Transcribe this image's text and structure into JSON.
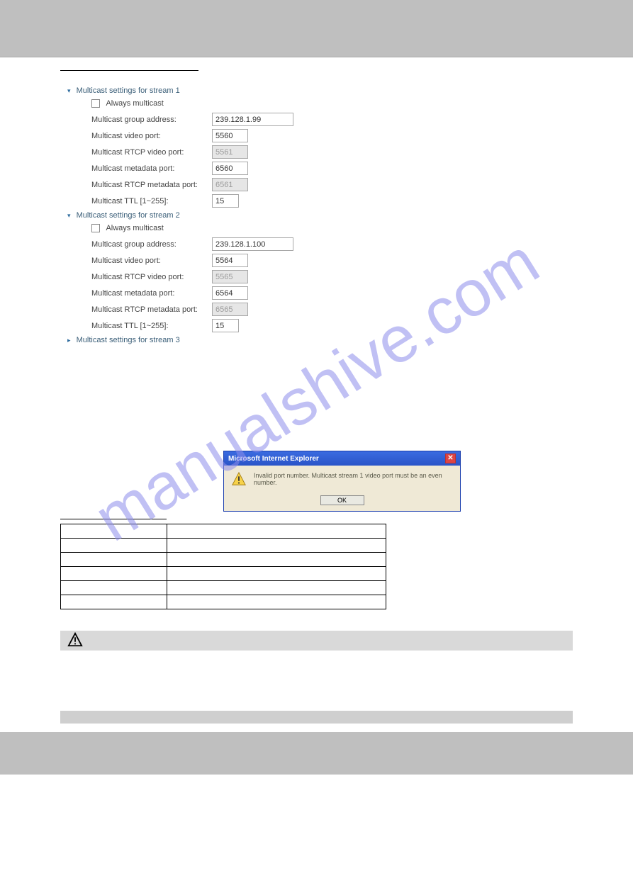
{
  "streams": [
    {
      "title": "Multicast settings for stream 1",
      "expanded": true,
      "always_multicast_label": "Always multicast",
      "fields": {
        "group_address": {
          "label": "Multicast group address:",
          "value": "239.128.1.99"
        },
        "video_port": {
          "label": "Multicast video port:",
          "value": "5560"
        },
        "rtcp_video_port": {
          "label": "Multicast RTCP video port:",
          "value": "5561"
        },
        "metadata_port": {
          "label": "Multicast metadata port:",
          "value": "6560"
        },
        "rtcp_metadata_port": {
          "label": "Multicast RTCP metadata port:",
          "value": "6561"
        },
        "ttl": {
          "label": "Multicast TTL [1~255]:",
          "value": "15"
        }
      }
    },
    {
      "title": "Multicast settings for stream 2",
      "expanded": true,
      "always_multicast_label": "Always multicast",
      "fields": {
        "group_address": {
          "label": "Multicast group address:",
          "value": "239.128.1.100"
        },
        "video_port": {
          "label": "Multicast video port:",
          "value": "5564"
        },
        "rtcp_video_port": {
          "label": "Multicast RTCP video port:",
          "value": "5565"
        },
        "metadata_port": {
          "label": "Multicast metadata port:",
          "value": "6564"
        },
        "rtcp_metadata_port": {
          "label": "Multicast RTCP metadata port:",
          "value": "6565"
        },
        "ttl": {
          "label": "Multicast TTL [1~255]:",
          "value": "15"
        }
      }
    },
    {
      "title": "Multicast settings for stream 3",
      "expanded": false
    }
  ],
  "dialog": {
    "title": "Microsoft Internet Explorer",
    "message": "Invalid port number. Multicast stream 1 video port must be an even number.",
    "ok": "OK"
  },
  "table": {
    "rows": [
      [
        "",
        ""
      ],
      [
        "",
        ""
      ],
      [
        "",
        ""
      ],
      [
        "",
        ""
      ],
      [
        "",
        ""
      ],
      [
        "",
        ""
      ]
    ]
  },
  "watermark": "manualshive.com"
}
